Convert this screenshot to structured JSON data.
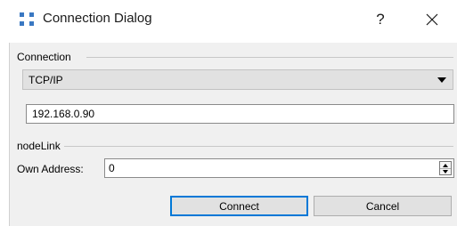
{
  "window": {
    "title": "Connection Dialog",
    "help_label": "?"
  },
  "connection": {
    "group_label": "Connection",
    "type_selected": "TCP/IP",
    "address_value": "192.168.0.90"
  },
  "nodelink": {
    "group_label": "nodeLink",
    "own_address_label": "Own Address:",
    "own_address_value": "0"
  },
  "buttons": {
    "connect_label": "Connect",
    "cancel_label": "Cancel"
  },
  "colors": {
    "accent": "#0078d7",
    "icon": "#3a78c2",
    "dialog_background": "#f0f0f0"
  }
}
